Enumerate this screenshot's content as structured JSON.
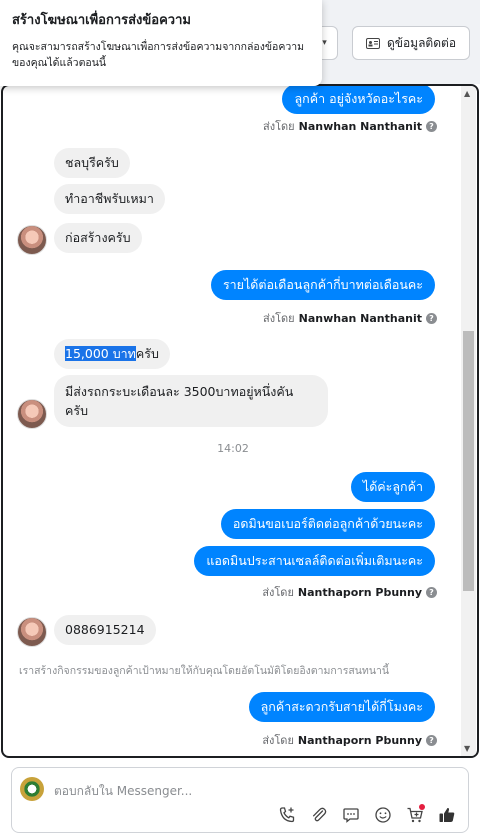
{
  "tooltip": {
    "title": "สร้างโฆษณาเพื่อการส่งข้อความ",
    "body": "คุณจะสามารถสร้างโฆษณาเพื่อการส่งข้อความจากกล่องข้อความของคุณได้แล้วตอนนี้"
  },
  "header": {
    "contact_label": "ดูข้อมูลติดต่อ"
  },
  "messages": {
    "m1": "ลูกค้า อยู่จังหวัดอะไรคะ",
    "m1_sentby_prefix": "ส่งโดย",
    "m1_sender": "Nanwhan Nanthanit",
    "m2": "ชลบุรีครับ",
    "m3": "ทำอาชีพรับเหมา",
    "m4": "ก่อสร้างครับ",
    "m5": "รายได้ต่อเดือนลูกค้ากี่บาทต่อเดือนคะ",
    "m5_sentby_prefix": "ส่งโดย",
    "m5_sender": "Nanwhan Nanthanit",
    "m6_highlight": "15,000 บาท",
    "m6_rest": "ครับ",
    "m7": "มีส่งรถกระบะเดือนละ 3500บาทอยู่หนึ่งคัน ครับ",
    "time": "14:02",
    "m8": "ได้ค่ะลูกค้า",
    "m9": "อดมินขอเบอร์ติดต่อลูกค้าด้วยนะคะ",
    "m10": "แอดมินประสานเซลล์ติดต่อเพิ่มเติมนะคะ",
    "m10_sentby_prefix": "ส่งโดย",
    "m10_sender": "Nanthaporn Pbunny",
    "m11": "0886915214",
    "system_note": "เราสร้างกิจกรรมของลูกค้าเป้าหมายให้กับคุณโดยอัตโนมัติโดยอิงตามการสนทนานี้",
    "m12": "ลูกค้าสะดวกรับสายได้กี่โมงคะ",
    "m12_sentby_prefix": "ส่งโดย",
    "m12_sender": "Nanthaporn Pbunny"
  },
  "composer": {
    "placeholder": "ตอบกลับใน Messenger..."
  },
  "icons": [
    "phone-add-icon",
    "paperclip-icon",
    "chat-icon",
    "emoji-icon",
    "cart-icon",
    "thumbs-up-icon"
  ],
  "colors": {
    "outgoing": "#0084ff",
    "incoming": "#f0f0f0",
    "highlight": "#1a73e8"
  }
}
